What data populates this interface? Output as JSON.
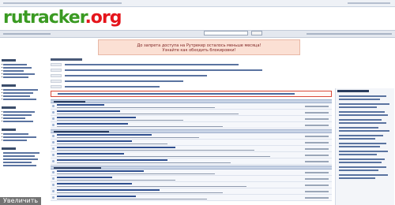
{
  "site": {
    "logo_part1": "rutracker",
    "logo_part2": ".org"
  },
  "notice": {
    "line1": "До запрета доступа на Рутрекер осталось меньше месяца!",
    "line2": "Узнайте как обходить блокировки!"
  },
  "overlay": {
    "zoom_label": "Увеличить"
  }
}
